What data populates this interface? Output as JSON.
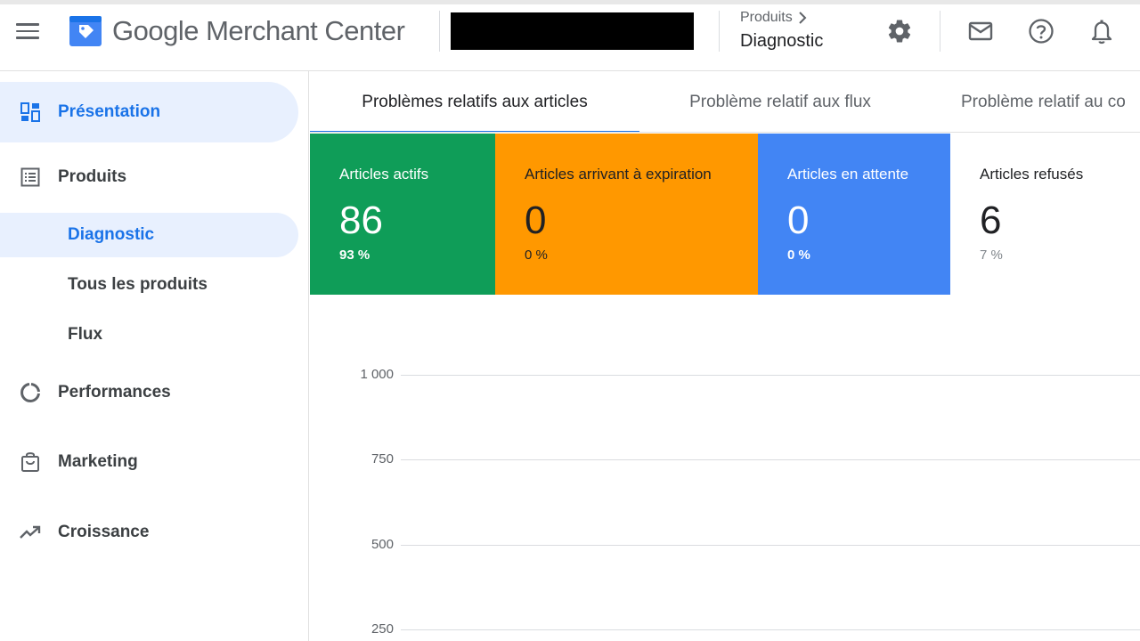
{
  "header": {
    "app_name": "Google Merchant Center",
    "breadcrumb_parent": "Produits",
    "breadcrumb_current": "Diagnostic",
    "icons": [
      "menu-icon",
      "merchant-logo-icon",
      "gear-icon",
      "mail-icon",
      "help-icon",
      "bell-icon"
    ]
  },
  "sidebar": {
    "items": [
      {
        "label": "Présentation",
        "icon": "dashboard-icon"
      },
      {
        "label": "Produits",
        "icon": "list-icon"
      },
      {
        "label": "Performances",
        "icon": "donut-icon"
      },
      {
        "label": "Marketing",
        "icon": "shopping-bag-icon"
      },
      {
        "label": "Croissance",
        "icon": "trending-up-icon"
      }
    ],
    "subitems": [
      {
        "label": "Diagnostic"
      },
      {
        "label": "Tous les produits"
      },
      {
        "label": "Flux"
      }
    ]
  },
  "tabs": [
    {
      "label": "Problèmes relatifs aux articles"
    },
    {
      "label": "Problème relatif aux flux"
    },
    {
      "label": "Problème relatif au co"
    }
  ],
  "cards": [
    {
      "title": "Articles actifs",
      "value": "86",
      "percent": "93 %",
      "color": "#0f9d58"
    },
    {
      "title": "Articles arrivant à expiration",
      "value": "0",
      "percent": "0 %",
      "color": "#ff9800"
    },
    {
      "title": "Articles en attente",
      "value": "0",
      "percent": "0 %",
      "color": "#4285f4"
    },
    {
      "title": "Articles refusés",
      "value": "6",
      "percent": "7 %",
      "color": "#ffffff"
    }
  ],
  "chart_data": {
    "type": "line",
    "y_ticks": [
      "1 000",
      "750",
      "500",
      "250"
    ],
    "grid": true
  }
}
